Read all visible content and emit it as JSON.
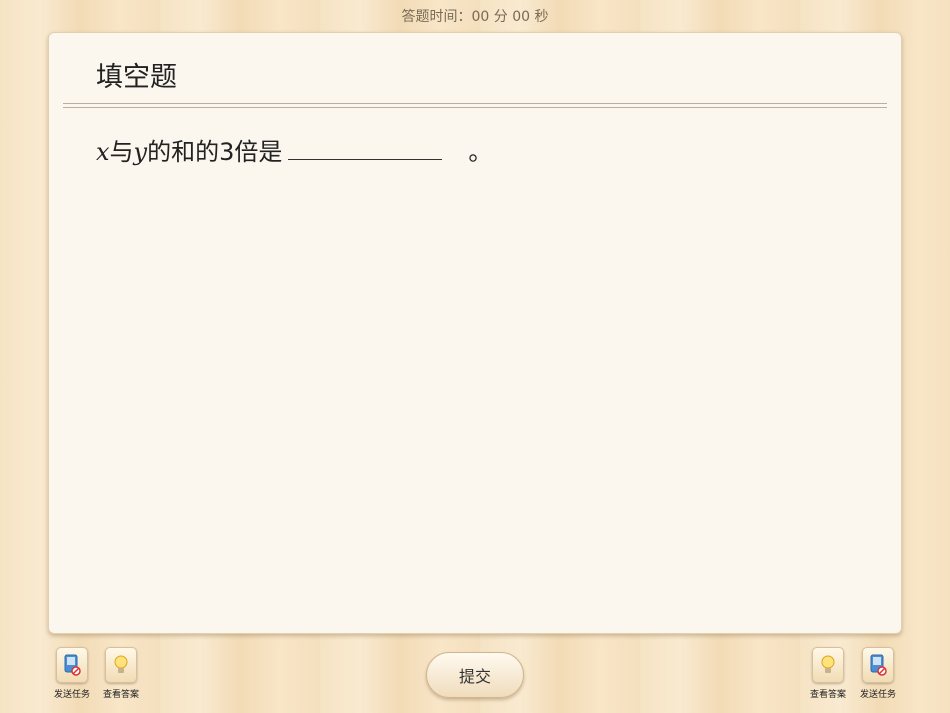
{
  "timer": {
    "text": "答题时间：00 分 00 秒"
  },
  "card": {
    "title": "填空题",
    "question": {
      "var_x": "x",
      "text1": "与",
      "var_y": "y",
      "text2": "的和的3倍是",
      "period": "。"
    }
  },
  "toolbar": {
    "left": [
      {
        "label": "发送任务",
        "icon": "send-task-icon"
      },
      {
        "label": "查看答案",
        "icon": "lightbulb-icon"
      }
    ],
    "right": [
      {
        "label": "查看答案",
        "icon": "lightbulb-icon"
      },
      {
        "label": "发送任务",
        "icon": "send-task-icon"
      }
    ],
    "submit_label": "提交"
  },
  "colors": {
    "card_bg": "#fbf6ee",
    "wood": "#f6e3c4",
    "accent": "#4a8fd6"
  }
}
